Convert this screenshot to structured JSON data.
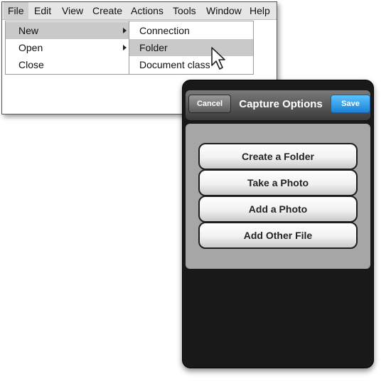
{
  "desktop": {
    "menubar": [
      {
        "label": "File",
        "active": true
      },
      {
        "label": "Edit"
      },
      {
        "label": "View"
      },
      {
        "label": "Create"
      },
      {
        "label": "Actions"
      },
      {
        "label": "Tools"
      },
      {
        "label": "Window"
      },
      {
        "label": "Help"
      }
    ],
    "file_menu": [
      {
        "label": "New",
        "has_submenu": true,
        "highlighted": true
      },
      {
        "label": "Open",
        "has_submenu": true
      },
      {
        "label": "Close"
      }
    ],
    "new_submenu": [
      {
        "label": "Connection"
      },
      {
        "label": "Folder",
        "highlighted": true
      },
      {
        "label": "Document class"
      }
    ]
  },
  "phone": {
    "cancel_label": "Cancel",
    "title": "Capture Options",
    "save_label": "Save",
    "options": [
      {
        "label": "Create a Folder"
      },
      {
        "label": "Take a Photo"
      },
      {
        "label": "Add a Photo"
      },
      {
        "label": "Add Other File"
      }
    ],
    "colors": {
      "save_button": "#1b82d6",
      "panel": "#a6a6a6",
      "frame": "#1a1919"
    }
  }
}
